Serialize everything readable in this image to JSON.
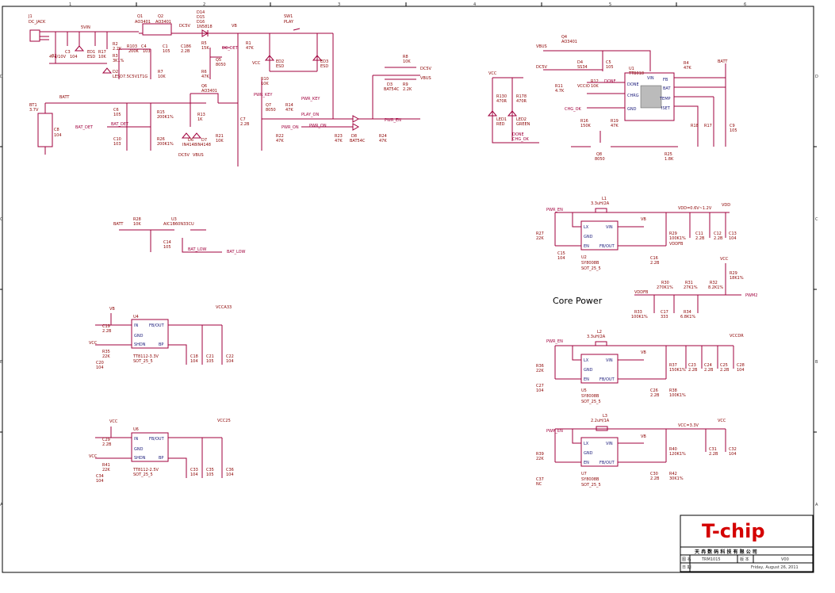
{
  "border": {
    "top_marks": [
      "1",
      "2",
      "3",
      "4",
      "5",
      "6"
    ],
    "side_marks": [
      "D",
      "C",
      "B",
      "A"
    ]
  },
  "title_block": {
    "logo": "T-chip",
    "company": "天 冉 数 码 科 技 有 限 公 司",
    "row1_label": "图  名",
    "row1_value": "TRM1015",
    "row1_label2": "版 本",
    "row1_value2": "V00",
    "row2_label": "日  期",
    "row2_value": "Friday, August 26, 2011"
  },
  "heading": "Core Power",
  "power_input": {
    "j1": "J1",
    "j1_type": "DC_JACK",
    "c2": "C2",
    "c2_val": "47u/10V",
    "c3": "C3",
    "c3_val": "104",
    "ed1": "ED1",
    "ed1_val": "ESD",
    "r17": "R17",
    "r17_val": "10K",
    "d5v": "5VIN",
    "q1": "Q1",
    "q1_val": "AO3401",
    "q2": "Q2",
    "q2_val": "AO3401",
    "r2": "R2",
    "r2_val": "2.2K",
    "r3": "R3",
    "r3_val": "3K1%",
    "r13x": "R103",
    "r13x_val": "200K",
    "c4": "C4",
    "c4_val": "103",
    "d2": "D2",
    "d2_val": "LESD7.5C5V1T1G",
    "r7": "R7",
    "r7_val": "10K",
    "dc5v": "DC5V",
    "c1": "C1",
    "c1_val": "105",
    "c186": "C186",
    "c186_val": "2.2B",
    "d14": "D14",
    "d15": "D15",
    "d16": "D16",
    "d16_val": "1N5818",
    "vb": "VB",
    "r5": "R5",
    "r5_val": "15K",
    "q5": "Q5",
    "q5_val": "8050",
    "r6": "R6",
    "r6_val": "47K",
    "dc_det": "DC_DET",
    "sw1": "SW1",
    "sw1_val": "PLAY",
    "r1": "R1",
    "r1_val": "47K",
    "vcc": "VCC",
    "ed2": "ED2",
    "ed2_val": "ESD",
    "ed3": "ED3",
    "ed3_val": "ESD",
    "r10": "R10",
    "r10_val": "10K",
    "pwr_key": "PWR_KEY",
    "pwr_key2": "PWR_KEY",
    "q7": "Q7",
    "q7_val": "8050",
    "r14": "R14",
    "r14_val": "47K",
    "c7": "C7",
    "c7_val": "2.2B",
    "play_on": "PLAY_ON",
    "pwr_on": "PWR_ON",
    "pwr_on2": "PWR_ON",
    "r22": "R22",
    "r22_val": "47K",
    "r23": "R23",
    "r23_val": "47K",
    "d8": "D8",
    "d8_val": "BAT54C",
    "r24": "R24",
    "r24_val": "47K",
    "pwr_en": "PWR_EN",
    "r8": "R8",
    "r8_val": "10K",
    "r9": "R9",
    "r9_val": "2.2K",
    "d3": "D3",
    "d3_val": "BAT54C",
    "dc5v2": "DC5V",
    "vbus": "VBUS",
    "bt1": "BT1",
    "bt1_val": "3.7V",
    "batt": "BATT",
    "c8": "C8",
    "c8_val": "104",
    "c6": "C6",
    "c6_val": "105",
    "c10": "C10",
    "c10_val": "103",
    "bat_det": "BAT_DET",
    "bat_det2": "BAT_DET",
    "r15": "R15",
    "r15_val": "200K1%",
    "r26": "R26",
    "r26_val": "200K1%",
    "q6": "Q6",
    "q6_val": "AO3401",
    "r13": "R13",
    "r13_val": "1K",
    "d6": "D6",
    "d6_val": "IN4148",
    "d7": "D7",
    "d7_val": "IN4148",
    "dc5v3": "DC5V",
    "vbus2": "VBUS",
    "r21": "R21",
    "r21_val": "10K"
  },
  "batt_low": {
    "batt": "BATT",
    "r28": "R28",
    "r28_val": "10K",
    "u3": "U3",
    "u3_val": "AIC1B60N33CU",
    "c14": "C14",
    "c14_val": "105",
    "bat_low": "BAT_LOW",
    "bat_low2": "BAT_LOW"
  },
  "charger": {
    "dc5v": "DC5V",
    "vbus": "VBUS",
    "q4": "Q4",
    "q4_val": "AO3401",
    "d4": "D4",
    "d4_val": "SS34",
    "c5": "C5",
    "c5_val": "105",
    "u1": "U1",
    "u1_val": "TTB018",
    "done": "DONE",
    "r4": "R4",
    "r4_val": "47K",
    "batt": "BATT",
    "r11": "R11",
    "r11_val": "4.7K",
    "vccio": "VCCIO",
    "r12": "R12",
    "r12_val": "10K",
    "chg_ok": "CHG_OK",
    "r16": "R16",
    "r16_val": "150K",
    "r19": "R19",
    "r19_val": "47K",
    "vcc": "VCC",
    "r130": "R130",
    "r130_val": "470R",
    "r178": "R178",
    "r178_val": "470R",
    "led1": "LED1",
    "led1_val": "RED",
    "led2": "LED2",
    "led2_val": "GREEN",
    "done2": "DONE",
    "chg_ok2": "CHG_OK",
    "q8": "Q8",
    "q8_val": "8050",
    "r25": "R25",
    "r25_val": "1.8K",
    "r18": "R18",
    "r17b": "R17",
    "c9": "C9",
    "c9_val": "105",
    "pins": [
      "DONE",
      "CHRG",
      "GND",
      "VIN",
      "FB",
      "BAT",
      "TEMP",
      "ISET"
    ]
  },
  "ldo": {
    "u4": {
      "ref": "U4",
      "vin": "VB",
      "out": "VCCA33",
      "part": "TT8112-3.3V",
      "pkg": "SOT_25_5",
      "c19": "C19",
      "c19_val": "2.2B",
      "r35": "R35",
      "r35_val": "22K",
      "c20": "C20",
      "c20_val": "104",
      "c18": "C18",
      "c18_val": "104",
      "c21": "C21",
      "c21_val": "105",
      "c22": "C22",
      "c22_val": "104",
      "vcc": "VCC"
    },
    "u6": {
      "ref": "U6",
      "vin": "VCC",
      "out": "VCC25",
      "part": "TT8112-2.5V",
      "pkg": "SOT_25_5",
      "c29": "C29",
      "c29_val": "2.2B",
      "r41": "R41",
      "r41_val": "22K",
      "c34": "C34",
      "c34_val": "104",
      "c33": "C33",
      "c33_val": "104",
      "c35": "C35",
      "c35_val": "105",
      "c36": "C36",
      "c36_val": "104",
      "vcc": "VCC"
    },
    "pins": [
      "IN",
      "GND",
      "SHDN",
      "FB/OUT",
      "BP"
    ]
  },
  "buck": {
    "u2": {
      "ref": "U2",
      "part": "SY8008B",
      "pkg": "SOT_25_5",
      "l": "L1",
      "l_val": "3.3uH/2A",
      "en": "PWR_EN",
      "vdd_note": "VDD=0.6V~1.2V",
      "vdd": "VDD",
      "vb": "VB",
      "r27": "R27",
      "r27_val": "22K",
      "c15": "C15",
      "c15_val": "104",
      "c16": "C16",
      "c16_val": "2.2B",
      "r29": "R29",
      "r29_val": "100K1%",
      "vddfb": "VDDFB",
      "c11": "C11",
      "c11_val": "2.2B",
      "c12": "C12",
      "c12_val": "2.2B",
      "c13": "C13",
      "c13_val": "104"
    },
    "u5": {
      "ref": "U5",
      "part": "SY8008B",
      "pkg": "SOT_25_5",
      "l": "L2",
      "l_val": "3.3uH/2A",
      "en": "PWR_EN",
      "out": "VCCDR",
      "vb": "VB",
      "r36": "R36",
      "r36_val": "22K",
      "c27": "C27",
      "c27_val": "104",
      "c26": "C26",
      "c26_val": "2.2B",
      "r37": "R37",
      "r37_val": "150K1%",
      "r38": "R38",
      "r38_val": "100K1%",
      "c23": "C23",
      "c23_val": "2.2B",
      "c24": "C24",
      "c24_val": "2.2B",
      "c25": "C25",
      "c25_val": "2.2B",
      "c28": "C28",
      "c28_val": "104"
    },
    "u7": {
      "ref": "U7",
      "part": "SY8008B",
      "pkg": "SOT_25_5",
      "l": "L3",
      "l_val": "2.2uH/1A",
      "en": "PWR_EN",
      "vcc_note": "VCC=3.3V",
      "vcc": "VCC",
      "vb": "VB",
      "r39": "R39",
      "r39_val": "22K",
      "c37": "C37",
      "c37_val": "NC",
      "c30": "C30",
      "c30_val": "2.2B",
      "r40": "R40",
      "r40_val": "120K1%",
      "r42": "R42",
      "r42_val": "30K1%",
      "c31": "C31",
      "c31_val": "2.2B",
      "c32": "C32",
      "c32_val": "104"
    },
    "pins": [
      "LX",
      "GND",
      "EN",
      "VIN",
      "FB/OUT"
    ]
  },
  "pwm_net": {
    "vcc": "VCC",
    "r29": "R29",
    "r29_val": "18K1%",
    "vddfb": "VDDFB",
    "r30": "R30",
    "r30_val": "270K1%",
    "r31": "R31",
    "r31_val": "27K1%",
    "r32": "R32",
    "r32_val": "8.2K1%",
    "pwm2": "PWM2",
    "r33": "R33",
    "r33_val": "100K1%",
    "c17": "C17",
    "c17_val": "333",
    "r34": "R34",
    "r34_val": "6.8K1%"
  }
}
